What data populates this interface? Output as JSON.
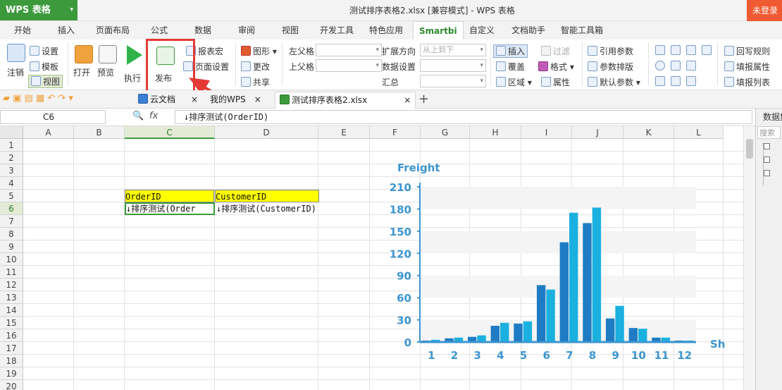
{
  "app": {
    "name": "WPS 表格",
    "window_title": "测试排序表格2.xlsx [兼容模式] - WPS 表格",
    "login": "未登录"
  },
  "menu_tabs": [
    "开始",
    "插入",
    "页面布局",
    "公式",
    "数据",
    "审阅",
    "视图",
    "开发工具",
    "特色应用",
    "Smartbi",
    "自定义",
    "文档助手",
    "智能工具箱"
  ],
  "active_tab": "Smartbi",
  "ribbon": {
    "logout": "注销",
    "settings": "设置",
    "template": "模板",
    "view": "视图",
    "open": "打开",
    "preview": "预览",
    "execute": "执行",
    "publish": "发布",
    "report_macro": "报表宏",
    "page_setup": "页面设置",
    "chart": "图形",
    "change": "更改",
    "share": "共享",
    "left_parent": "左父格",
    "top_parent": "上父格",
    "expand_dir": "扩展方向",
    "expand_dir_value": "从上到下",
    "data_setting": "数据设置",
    "summary": "汇总",
    "insert": "插入",
    "overwrite": "覆盖",
    "region": "区域",
    "filter": "过滤",
    "format": "格式",
    "property": "属性",
    "ref_param": "引用参数",
    "param_layout": "参数排版",
    "default_param": "默认参数",
    "writeback_rule": "回写规则",
    "fill_property": "填报属性",
    "fill_list": "填报列表"
  },
  "doc_tabs": {
    "cloud": "云文档",
    "mywps": "我的WPS",
    "file": "测试排序表格2.xlsx"
  },
  "formula_bar": {
    "cell_ref": "C6",
    "fx": "fx",
    "content": "↓排序测试(OrderID)"
  },
  "columns": [
    "A",
    "B",
    "C",
    "D",
    "E",
    "F",
    "G",
    "H",
    "I",
    "J",
    "K",
    "L"
  ],
  "rows": [
    "1",
    "2",
    "3",
    "4",
    "5",
    "6",
    "7",
    "8",
    "9",
    "10",
    "11",
    "12",
    "13",
    "14",
    "15",
    "16",
    "17",
    "18",
    "19",
    "20"
  ],
  "cells": {
    "C5": "OrderID",
    "D5": "CustomerID",
    "C6": "↓排序测试(Order",
    "D6": "↓排序测试(CustomerID)"
  },
  "side_panel": {
    "title": "数据集",
    "search": "搜索"
  },
  "colors": {
    "accent": "#3c9a3c",
    "highlight": "#e53935",
    "bar_dark": "#1f7cc4",
    "bar_light": "#1ab0e0",
    "header_yellow": "#ffff00"
  },
  "chart_data": {
    "type": "bar",
    "title": "Freight",
    "xlabel": "Sh",
    "categories": [
      "1",
      "2",
      "3",
      "4",
      "5",
      "6",
      "7",
      "8",
      "9",
      "10",
      "11",
      "12"
    ],
    "ylim": [
      0,
      210
    ],
    "yticks": [
      0,
      30,
      60,
      90,
      120,
      150,
      180,
      210
    ],
    "series": [
      {
        "values": [
          2,
          5,
          7,
          22,
          25,
          77,
          135,
          161,
          32,
          19,
          6,
          2
        ]
      },
      {
        "values": [
          3,
          6,
          9,
          26,
          28,
          71,
          175,
          182,
          49,
          18,
          6,
          2
        ]
      }
    ]
  }
}
